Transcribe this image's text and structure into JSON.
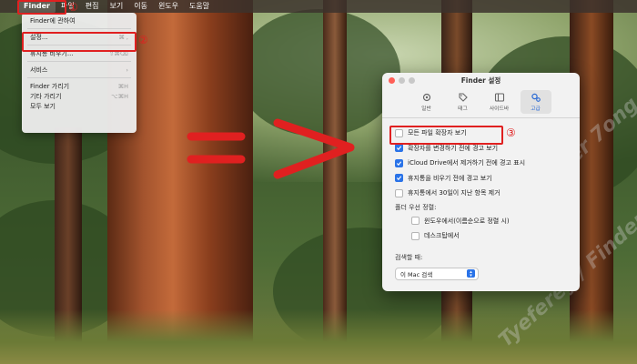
{
  "menubar": {
    "apple_icon": "apple-logo-icon",
    "items": [
      "Finder",
      "파일",
      "편집",
      "보기",
      "이동",
      "윈도우",
      "도움말"
    ]
  },
  "finder_menu": {
    "about": "Finder에 관하여",
    "settings": "설정...",
    "settings_shortcut": "⌘ ,",
    "empty_trash": "휴지통 비우기...",
    "empty_trash_shortcut": "⇧⌘⌫",
    "services": "서비스",
    "hide_finder": "Finder 가리기",
    "hide_finder_shortcut": "⌘H",
    "hide_others": "기타 가리기",
    "hide_others_shortcut": "⌥⌘H",
    "show_all": "모두 보기"
  },
  "annotations": {
    "step1": "①",
    "step2": "②",
    "step3": "③",
    "color": "#e02020"
  },
  "settings_window": {
    "title": "Finder 설정",
    "tabs": [
      {
        "label": "일반",
        "icon": "gear-icon"
      },
      {
        "label": "태그",
        "icon": "tag-icon"
      },
      {
        "label": "사이드바",
        "icon": "sidebar-icon"
      },
      {
        "label": "고급",
        "icon": "gears-icon",
        "active": true
      }
    ],
    "options": {
      "show_extensions": {
        "label": "모든 파일 확장자 보기",
        "checked": false
      },
      "warn_extension": {
        "label": "확장자를 변경하기 전에 경고 보기",
        "checked": true
      },
      "warn_icloud": {
        "label": "iCloud Drive에서 제거하기 전에 경고 표시",
        "checked": true
      },
      "warn_trash": {
        "label": "휴지통을 비우기 전에 경고 보기",
        "checked": true
      },
      "remove_30": {
        "label": "휴지통에서 30일이 지난 항목 제거",
        "checked": false
      }
    },
    "folders_top_label": "폴더 우선 정렬:",
    "folders_windows": {
      "label": "윈도우에서(이름순으로 정렬 시)",
      "checked": false
    },
    "folders_desktop": {
      "label": "데스크탑에서",
      "checked": false
    },
    "search_label": "검색할 때:",
    "search_value": "이 Mac 검색"
  },
  "accent_color": "#2a73e8",
  "watermark": "Tyeferey / Finder 7ong / Storwey"
}
